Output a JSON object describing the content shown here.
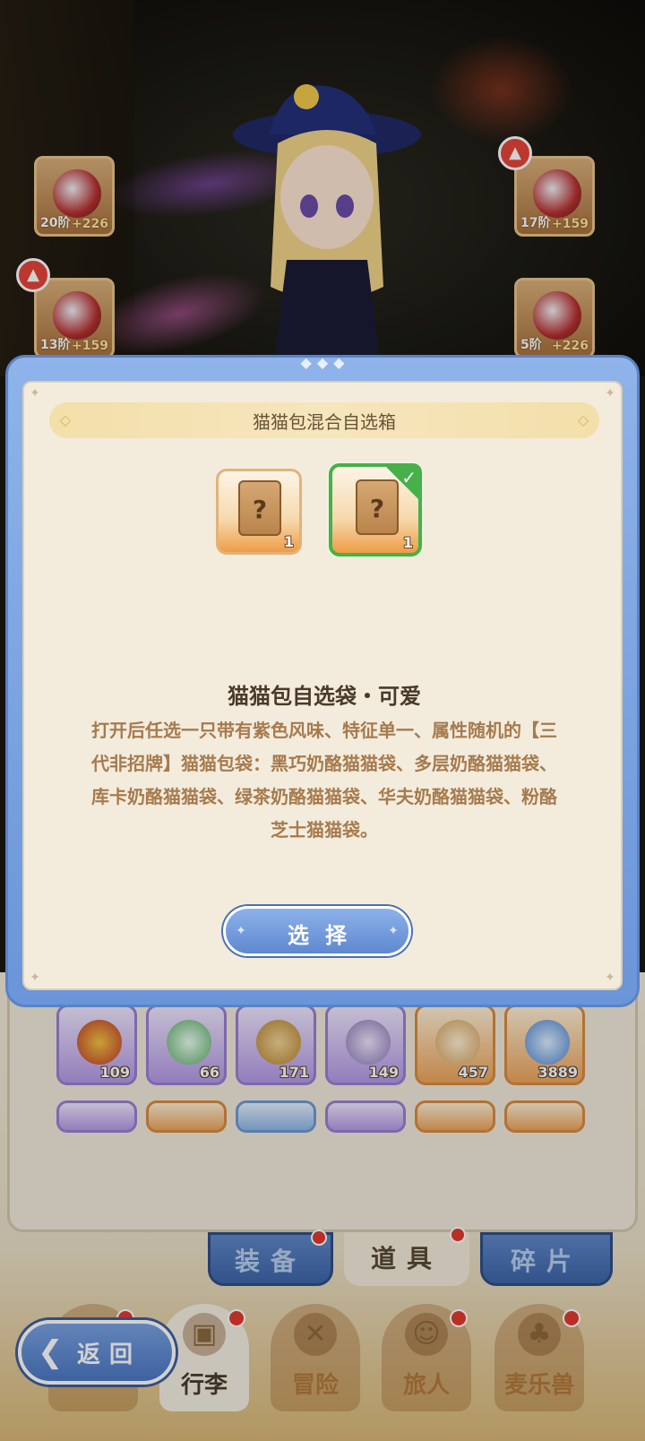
{
  "scene": {
    "equipment": [
      {
        "level": "20阶",
        "power": "+226"
      },
      {
        "level": "17阶",
        "power": "+159"
      },
      {
        "level": "13阶",
        "power": "+159"
      },
      {
        "level": "5阶",
        "power": "+226"
      }
    ]
  },
  "modal": {
    "title": "猫猫包混合自选箱",
    "choices": [
      {
        "qty": "1",
        "selected": false
      },
      {
        "qty": "1",
        "selected": true
      }
    ],
    "item_name": "猫猫包自选袋・可爱",
    "item_desc": "打开后任选一只带有紫色风味、特征单一、属性随机的【三代非招牌】猫猫包袋：黑巧奶酪猫猫袋、多层奶酪猫猫袋、库卡奶酪猫猫袋、绿茶奶酪猫猫袋、华夫奶酪猫猫袋、粉酪芝士猫猫袋。",
    "select_label": "选择"
  },
  "inventory": {
    "row1": [
      {
        "count": "109",
        "icon": "horseshoe-icon"
      },
      {
        "count": "66",
        "icon": "bottle-icon"
      },
      {
        "count": "171",
        "icon": "bread-icon"
      },
      {
        "count": "149",
        "icon": "spoon-icon"
      },
      {
        "count": "457",
        "icon": "flour-sack-icon"
      },
      {
        "count": "3889",
        "icon": "star-crystal-icon"
      }
    ]
  },
  "tabs": [
    {
      "label": "装备"
    },
    {
      "label": "道具"
    },
    {
      "label": "碎片"
    }
  ],
  "nav": [
    {
      "label": "行李"
    },
    {
      "label": "冒险"
    },
    {
      "label": "旅人"
    },
    {
      "label": "麦乐兽"
    }
  ],
  "back_label": "返回",
  "colors": {
    "accent_blue": "#6b95d9",
    "panel_cream": "#f3ecdd",
    "select_green": "#47b04a",
    "text_brown": "#a67a4d"
  }
}
